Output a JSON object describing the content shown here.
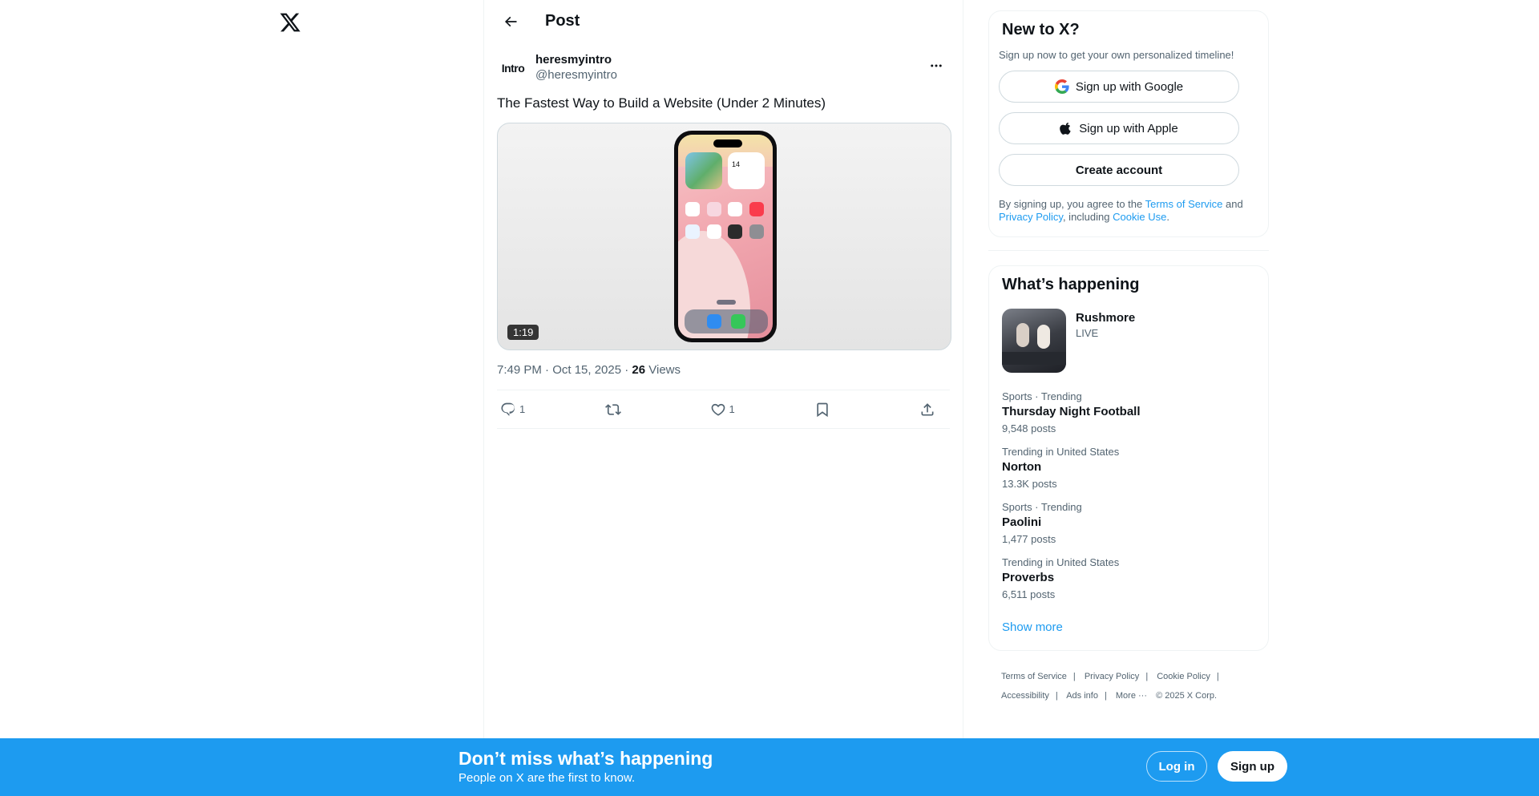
{
  "nav": {
    "logo_icon": "x-logo-icon"
  },
  "header": {
    "title": "Post",
    "back_icon": "arrow-left-icon"
  },
  "post": {
    "avatar_text": "Intro",
    "display_name": "heresmyintro",
    "handle": "@heresmyintro",
    "text": "The Fastest Way to Build a Website (Under 2 Minutes)",
    "media": {
      "duration": "1:19",
      "phone_date": "14"
    },
    "time": "7:49 PM · Oct 15, 2025 · ",
    "views_count": "26",
    "views_label": " Views",
    "actions": {
      "replies": "1",
      "reposts": "",
      "likes": "1"
    }
  },
  "signup": {
    "title": "New to X?",
    "subtitle": "Sign up now to get your own personalized timeline!",
    "google_label": "Sign up with Google",
    "apple_label": "Sign up with Apple",
    "create_label": "Create account",
    "legal_prefix": "By signing up, you agree to the ",
    "terms": "Terms of Service",
    "legal_and": " and ",
    "privacy": "Privacy Policy",
    "legal_including": ", including ",
    "cookie": "Cookie Use",
    "legal_end": "."
  },
  "trends": {
    "title": "What’s happening",
    "live": {
      "name": "Rushmore",
      "status": "LIVE"
    },
    "items": [
      {
        "category": "Sports · Trending",
        "name": "Thursday Night Football",
        "posts": "9,548 posts"
      },
      {
        "category": "Trending in United States",
        "name": "Norton",
        "posts": "13.3K posts"
      },
      {
        "category": "Sports · Trending",
        "name": "Paolini",
        "posts": "1,477 posts"
      },
      {
        "category": "Trending in United States",
        "name": "Proverbs",
        "posts": "6,511 posts"
      }
    ],
    "show_more": "Show more"
  },
  "footer": {
    "terms": "Terms of Service",
    "privacy": "Privacy Policy",
    "cookie": "Cookie Policy",
    "accessibility": "Accessibility",
    "ads": "Ads info",
    "more": "More ···",
    "copyright": "© 2025 X Corp."
  },
  "banner": {
    "title": "Don’t miss what’s happening",
    "subtitle": "People on X are the first to know.",
    "login": "Log in",
    "signup": "Sign up"
  },
  "colors": {
    "accent": "#1d9bf0",
    "text": "#0f1419",
    "muted": "#536471",
    "border": "#eff3f4"
  }
}
